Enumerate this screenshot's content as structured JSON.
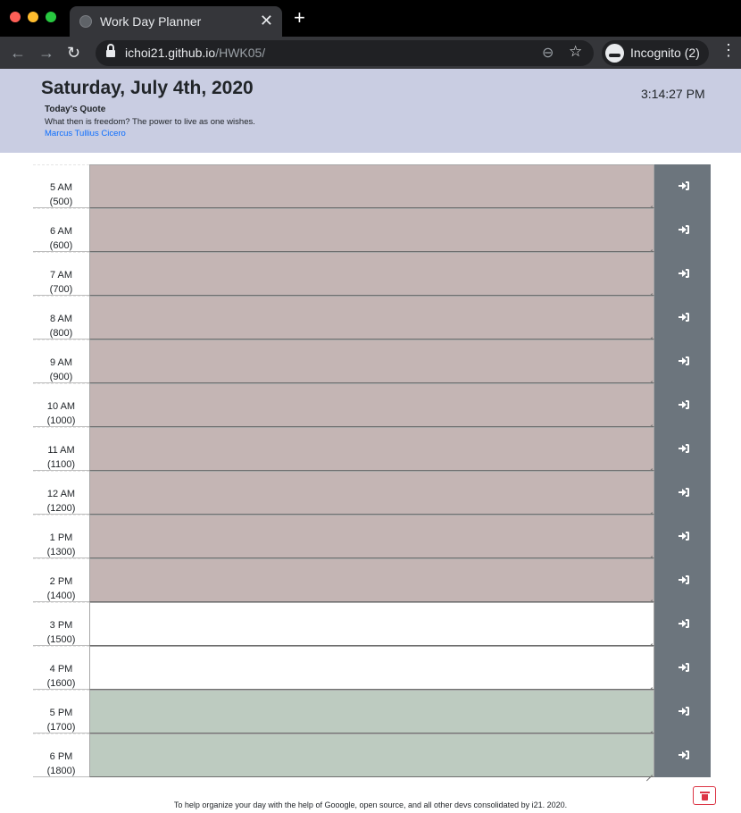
{
  "browser": {
    "tab_title": "Work Day Planner",
    "tab_close": "✕",
    "new_tab": "+",
    "url_host": "ichoi21.github.io",
    "url_path": "/HWK05/",
    "incognito_label": "Incognito (2)",
    "icons": [
      "back-arrow-icon",
      "forward-arrow-icon",
      "reload-icon",
      "lock-icon",
      "zoom-out-icon",
      "star-icon",
      "incognito-icon",
      "kebab-menu-icon"
    ]
  },
  "header": {
    "date": "Saturday, July 4th, 2020",
    "time": "3:14:27 PM",
    "quote_heading": "Today's Quote",
    "quote_text": "What then is freedom? The power to live as one wishes.",
    "quote_author": "Marcus Tullius Cicero"
  },
  "planner": {
    "colors": {
      "past": "#c4b5b4",
      "present": "#ffffff",
      "future": "#bdcbc0",
      "save_button": "#6c757d",
      "header_bg": "#c9cde2"
    },
    "rows": [
      {
        "hour": "5 AM",
        "code": "(500)",
        "state": "past",
        "text": ""
      },
      {
        "hour": "6 AM",
        "code": "(600)",
        "state": "past",
        "text": ""
      },
      {
        "hour": "7 AM",
        "code": "(700)",
        "state": "past",
        "text": ""
      },
      {
        "hour": "8 AM",
        "code": "(800)",
        "state": "past",
        "text": ""
      },
      {
        "hour": "9 AM",
        "code": "(900)",
        "state": "past",
        "text": ""
      },
      {
        "hour": "10 AM",
        "code": "(1000)",
        "state": "past",
        "text": ""
      },
      {
        "hour": "11 AM",
        "code": "(1100)",
        "state": "past",
        "text": ""
      },
      {
        "hour": "12 AM",
        "code": "(1200)",
        "state": "past",
        "text": ""
      },
      {
        "hour": "1 PM",
        "code": "(1300)",
        "state": "past",
        "text": ""
      },
      {
        "hour": "2 PM",
        "code": "(1400)",
        "state": "past",
        "text": ""
      },
      {
        "hour": "3 PM",
        "code": "(1500)",
        "state": "present",
        "text": ""
      },
      {
        "hour": "4 PM",
        "code": "(1600)",
        "state": "present",
        "text": ""
      },
      {
        "hour": "5 PM",
        "code": "(1700)",
        "state": "future",
        "text": ""
      },
      {
        "hour": "6 PM",
        "code": "(1800)",
        "state": "future",
        "text": ""
      }
    ]
  },
  "footer": {
    "text": "To help organize your day with the help of Gooogle, open source, and all other devs consolidated by i21. 2020."
  }
}
